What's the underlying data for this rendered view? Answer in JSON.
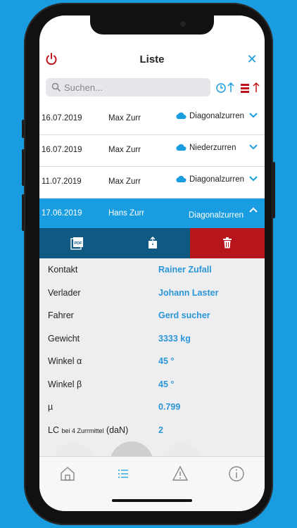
{
  "header": {
    "title": "Liste"
  },
  "search": {
    "placeholder": "Suchen..."
  },
  "list": [
    {
      "date": "16.07.2019",
      "name": "Max Zurr",
      "type": "Diagonalzurren"
    },
    {
      "date": "16.07.2019",
      "name": "Max Zurr",
      "type": "Niederzurren"
    },
    {
      "date": "11.07.2019",
      "name": "Max Zurr",
      "type": "Diagonalzurren"
    },
    {
      "date": "17.06.2019",
      "name": "Hans Zurr",
      "type": "Diagonalzurren"
    }
  ],
  "actions": {
    "pdf_label": "PDF"
  },
  "details": [
    {
      "label": "Kontakt",
      "value": "Rainer Zufall"
    },
    {
      "label": "Verlader",
      "value": "Johann Laster"
    },
    {
      "label": "Fahrer",
      "value": "Gerd sucher"
    },
    {
      "label": "Gewicht",
      "value": "3333 kg"
    },
    {
      "label": "Winkel α",
      "value": "45 °"
    },
    {
      "label": "Winkel β",
      "value": "45 °"
    },
    {
      "label": "µ",
      "value": "0.799"
    },
    {
      "label_main": "LC",
      "label_small": "bei 4 Zurrmittel",
      "label_unit": "(daN)",
      "value": "2"
    }
  ],
  "colors": {
    "accent": "#1a9de0",
    "pdf_bg": "#0f5a82",
    "share_bg": "#0f5a82",
    "delete_bg": "#b5151b",
    "power": "#c0141a"
  },
  "tabs": [
    "home-icon",
    "list-icon",
    "warning-icon",
    "info-icon"
  ]
}
